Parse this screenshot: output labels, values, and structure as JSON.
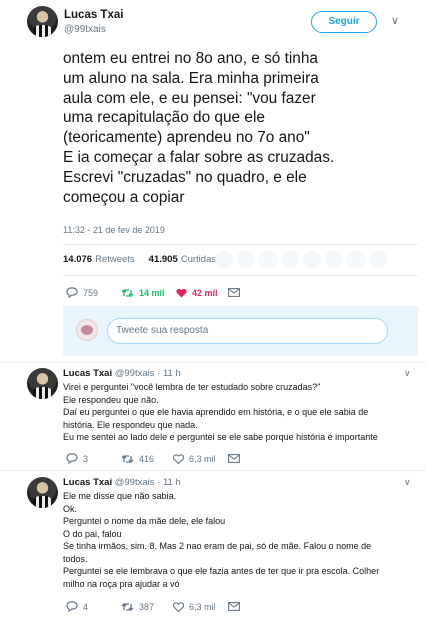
{
  "tweet": {
    "author_name": "Lucas Txai",
    "author_handle": "@99txais",
    "follow_label": "Seguir",
    "text": "ontem eu entrei no 8o ano, e só tinha\num aluno na sala. Era minha primeira\naula com ele, e eu pensei: \"vou fazer\numa recapitulação do que ele\n(teoricamente) aprendeu no 7o ano\"\nE ia começar a falar sobre as cruzadas.\nEscrevi \"cruzadas\" no quadro, e ele\ncomeçou a copiar",
    "timestamp": "11:32 - 21 de fev de 2019",
    "retweets_count": "14.076",
    "retweets_label": "Retweets",
    "likes_count": "41.905",
    "likes_label": "Curtidas",
    "actions": {
      "replies": "759",
      "retweets": "14 mil",
      "likes": "42 mil"
    }
  },
  "reply_box": {
    "placeholder": "Tweete sua resposta"
  },
  "replies": [
    {
      "author_name": "Lucas Txai",
      "author_handle": "@99txais",
      "time": "· 11 h",
      "text": "Virei e perguntei \"você lembra de ter estudado sobre cruzadas?\"\nEle respondeu que não.\nDaí eu perguntei o que ele havia aprendido em história, e o que ele sabia de\nhistória. Ele respondeu que nada.\nEu me sentei ao lado dele e perguntei se ele sabe porque história é importante",
      "actions": {
        "replies": "3",
        "retweets": "416",
        "likes": "6,3 mil"
      }
    },
    {
      "author_name": "Lucas Txai",
      "author_handle": "@99txais",
      "time": "· 11 h",
      "text": "Ele me disse que não sabia.\nOk.\nPerguntei o nome da mãe dele, ele falou\nO do pai, falou\nSe tinha irmãos, sim. 8. Mas 2 nao eram de pai, só de mãe. Falou o nome de\ntodos.\nPerguntei se ele lembrava o que ele fazia antes de ter que ir pra escola. Colher\nmilho na roça pra ajudar a vó",
      "actions": {
        "replies": "4",
        "retweets": "387",
        "likes": "6,3 mil"
      }
    }
  ],
  "colors": {
    "accent": "#1da1f2",
    "retweet_green": "#17bf63",
    "like_red": "#e0245e",
    "muted": "#657786"
  },
  "icons": [
    "reply-icon",
    "retweet-icon",
    "heart-icon",
    "mail-icon",
    "chevron-down-icon"
  ]
}
